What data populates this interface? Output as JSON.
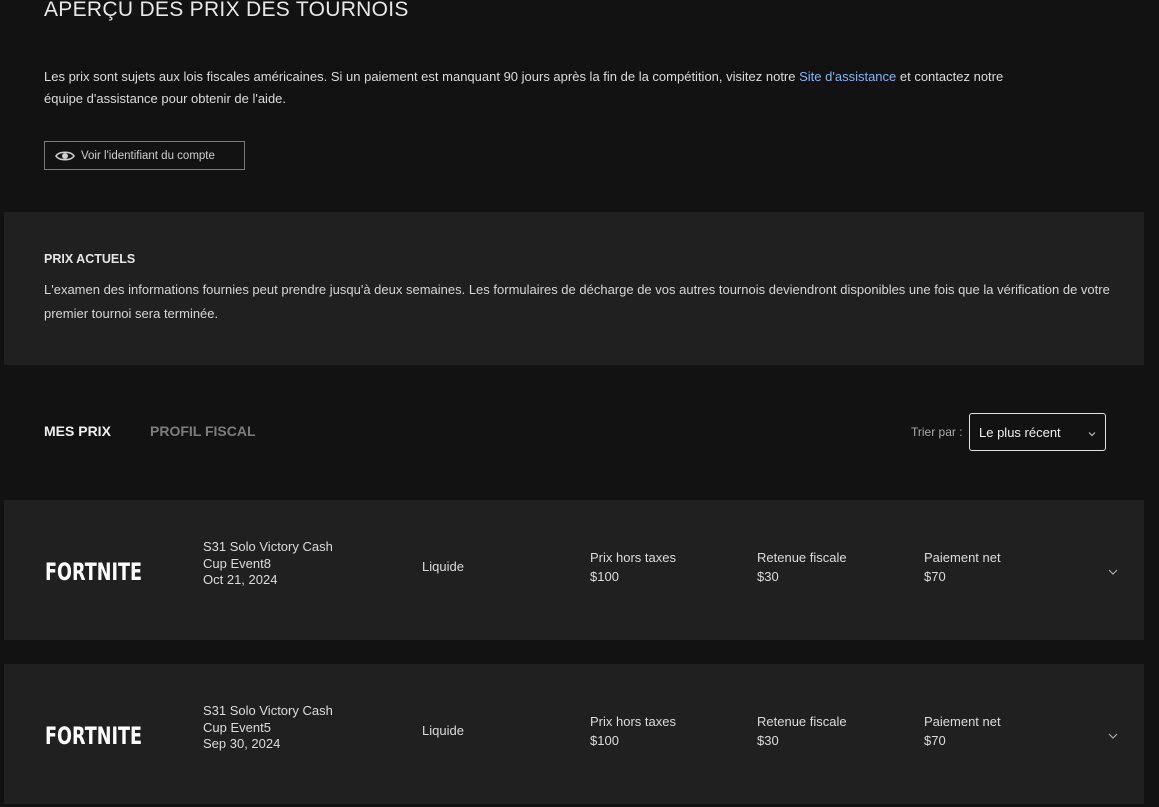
{
  "header": {
    "title": "APERÇU DES PRIX DES TOURNOIS",
    "intro_before_link": "Les prix sont sujets aux lois fiscales américaines. Si un paiement est manquant 90 jours après la fin de la compétition, visitez notre ",
    "intro_link": "Site d'assistance",
    "intro_after_link": " et contactez notre équipe d'assistance pour obtenir de l'aide.",
    "view_account_button": "Voir l'identifiant du compte"
  },
  "current_prizes": {
    "title": "PRIX ACTUELS",
    "text": "L'examen des informations fournies peut prendre jusqu'à deux semaines. Les formulaires de décharge de vos autres tournois deviendront disponibles une fois que la vérification de votre premier tournoi sera terminée."
  },
  "tabs": [
    {
      "label": "MES PRIX",
      "active": true
    },
    {
      "label": "PROFIL FISCAL",
      "active": false
    }
  ],
  "sort": {
    "label": "Trier par :",
    "selected": "Le plus récent"
  },
  "prizes": [
    {
      "game_logo": "FORTNITE",
      "event_line1": "S31 Solo Victory Cash",
      "event_line2": "Cup Event8",
      "date": "Oct 21, 2024",
      "type": "Liquide",
      "gross_label": "Prix hors taxes",
      "gross_value": "$100",
      "withholding_label": "Retenue fiscale",
      "withholding_value": "$30",
      "net_label": "Paiement net",
      "net_value": "$70"
    },
    {
      "game_logo": "FORTNITE",
      "event_line1": "S31 Solo Victory Cash",
      "event_line2": "Cup Event5",
      "date": "Sep 30, 2024",
      "type": "Liquide",
      "gross_label": "Prix hors taxes",
      "gross_value": "$100",
      "withholding_label": "Retenue fiscale",
      "withholding_value": "$30",
      "net_label": "Paiement net",
      "net_value": "$70"
    }
  ],
  "colors": {
    "background": "#121212",
    "panel": "#202020",
    "link": "#7fb6ff",
    "inactive_tab": "#7d7d7d"
  },
  "icons": [
    "eye-icon",
    "chevron-down-icon",
    "fortnite-logo"
  ]
}
